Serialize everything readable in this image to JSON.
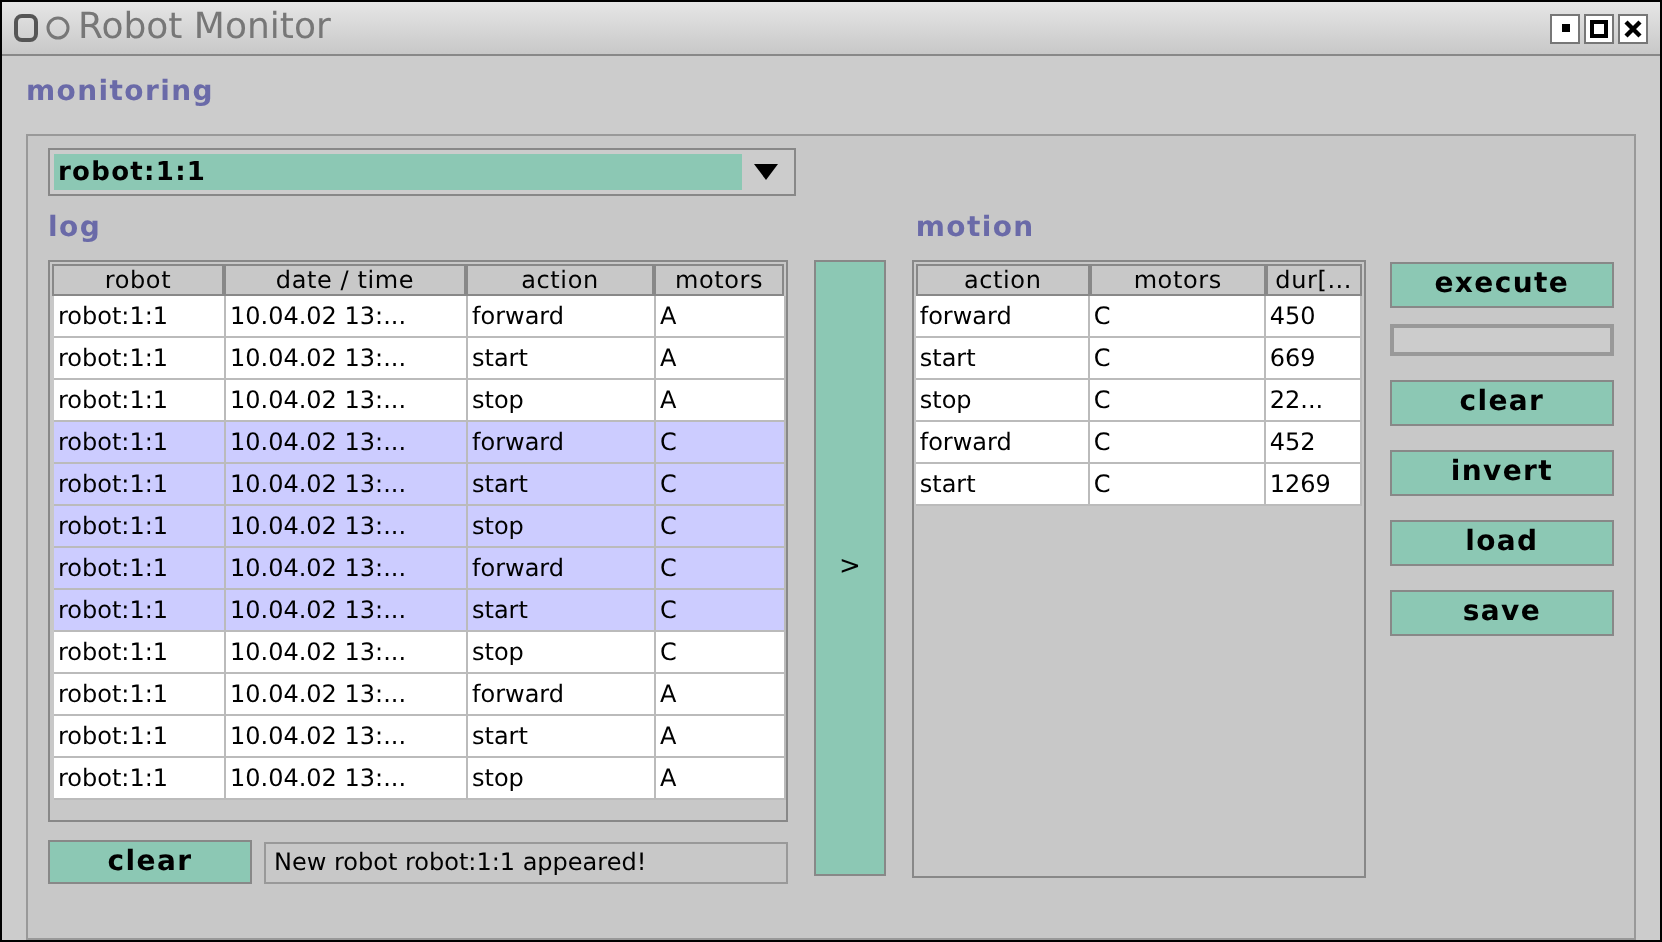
{
  "window": {
    "title": "Robot Monitor"
  },
  "section_title": "monitoring",
  "robot_select": {
    "value": "robot:1:1"
  },
  "log": {
    "title": "log",
    "columns": [
      "robot",
      "date / time",
      "action",
      "motors"
    ],
    "rows": [
      {
        "cells": [
          "robot:1:1",
          "10.04.02 13:...",
          "forward",
          "A"
        ],
        "selected": false
      },
      {
        "cells": [
          "robot:1:1",
          "10.04.02 13:...",
          "start",
          "A"
        ],
        "selected": false
      },
      {
        "cells": [
          "robot:1:1",
          "10.04.02 13:...",
          "stop",
          "A"
        ],
        "selected": false
      },
      {
        "cells": [
          "robot:1:1",
          "10.04.02 13:...",
          "forward",
          "C"
        ],
        "selected": true
      },
      {
        "cells": [
          "robot:1:1",
          "10.04.02 13:...",
          "start",
          "C"
        ],
        "selected": true
      },
      {
        "cells": [
          "robot:1:1",
          "10.04.02 13:...",
          "stop",
          "C"
        ],
        "selected": true
      },
      {
        "cells": [
          "robot:1:1",
          "10.04.02 13:...",
          "forward",
          "C"
        ],
        "selected": true
      },
      {
        "cells": [
          "robot:1:1",
          "10.04.02 13:...",
          "start",
          "C"
        ],
        "selected": true
      },
      {
        "cells": [
          "robot:1:1",
          "10.04.02 13:...",
          "stop",
          "C"
        ],
        "selected": false
      },
      {
        "cells": [
          "robot:1:1",
          "10.04.02 13:...",
          "forward",
          "A"
        ],
        "selected": false
      },
      {
        "cells": [
          "robot:1:1",
          "10.04.02 13:...",
          "start",
          "A"
        ],
        "selected": false
      },
      {
        "cells": [
          "robot:1:1",
          "10.04.02 13:...",
          "stop",
          "A"
        ],
        "selected": false
      }
    ],
    "clear_button": "clear",
    "status": "New robot robot:1:1 appeared!"
  },
  "transfer_button": ">",
  "motion": {
    "title": "motion",
    "columns": [
      "action",
      "motors",
      "dur[..."
    ],
    "rows": [
      {
        "cells": [
          "forward",
          "C",
          "450"
        ]
      },
      {
        "cells": [
          "start",
          "C",
          "669"
        ]
      },
      {
        "cells": [
          "stop",
          "C",
          "22..."
        ]
      },
      {
        "cells": [
          "forward",
          "C",
          "452"
        ]
      },
      {
        "cells": [
          "start",
          "C",
          "1269"
        ]
      }
    ]
  },
  "progress": {
    "level": 0
  },
  "buttons": [
    "execute",
    "clear",
    "invert",
    "load",
    "save"
  ]
}
